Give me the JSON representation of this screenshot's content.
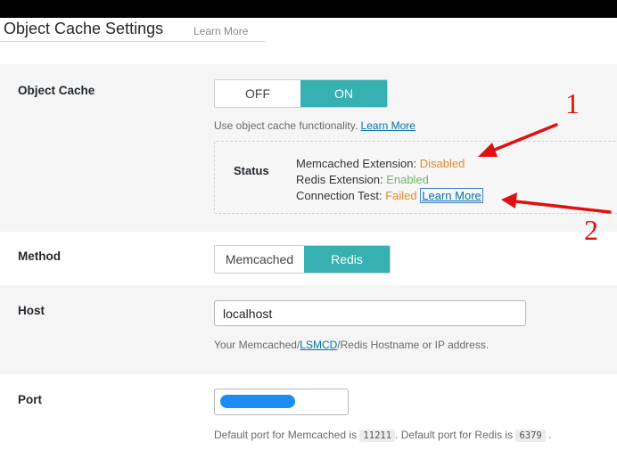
{
  "header": {
    "title": "Object Cache Settings",
    "learn_more": "Learn More"
  },
  "object_cache": {
    "label": "Object Cache",
    "toggle_off": "OFF",
    "toggle_on": "ON",
    "selected": "ON",
    "desc_prefix": "Use object cache functionality.",
    "desc_link": "Learn More"
  },
  "status": {
    "label": "Status",
    "memcached_label": "Memcached Extension:",
    "memcached_value": "Disabled",
    "redis_label": "Redis Extension:",
    "redis_value": "Enabled",
    "connection_label": "Connection Test:",
    "connection_value": "Failed",
    "connection_link": "Learn More"
  },
  "method": {
    "label": "Method",
    "option_memcached": "Memcached",
    "option_redis": "Redis",
    "selected": "Redis"
  },
  "host": {
    "label": "Host",
    "value": "localhost",
    "desc_prefix": "Your Memcached/",
    "desc_link": "LSMCD",
    "desc_suffix": "/Redis Hostname or IP address."
  },
  "port": {
    "label": "Port",
    "desc_part1": "Default port for Memcached is",
    "memcached_port": "11211",
    "desc_part2": ". Default port for Redis is",
    "redis_port": "6379",
    "desc_part3": "."
  },
  "annotations": {
    "marker_1": "1",
    "marker_2": "2",
    "color": "#e01010"
  },
  "colors": {
    "accent": "#36b0b0",
    "link": "#0073aa",
    "warning": "#e3892a",
    "success": "#6cb86c"
  }
}
